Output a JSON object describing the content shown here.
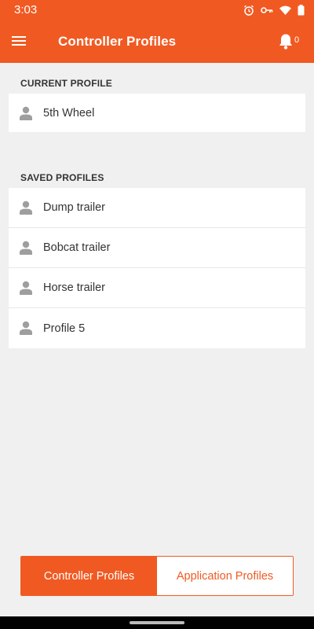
{
  "status": {
    "time": "3:03"
  },
  "appbar": {
    "title": "Controller Profiles",
    "notification_count": "0",
    "accent_color": "#f05a22"
  },
  "current_profile": {
    "heading": "CURRENT PROFILE",
    "items": [
      {
        "label": "5th Wheel",
        "icon": "person-icon"
      }
    ]
  },
  "saved_profiles": {
    "heading": "SAVED PROFILES",
    "items": [
      {
        "label": "Dump trailer",
        "icon": "person-icon"
      },
      {
        "label": "Bobcat trailer",
        "icon": "person-icon"
      },
      {
        "label": "Horse trailer",
        "icon": "person-icon"
      },
      {
        "label": "Profile 5",
        "icon": "person-icon"
      }
    ]
  },
  "tabs": {
    "controller_label": "Controller Profiles",
    "application_label": "Application Profiles",
    "selected": "Controller Profiles"
  }
}
